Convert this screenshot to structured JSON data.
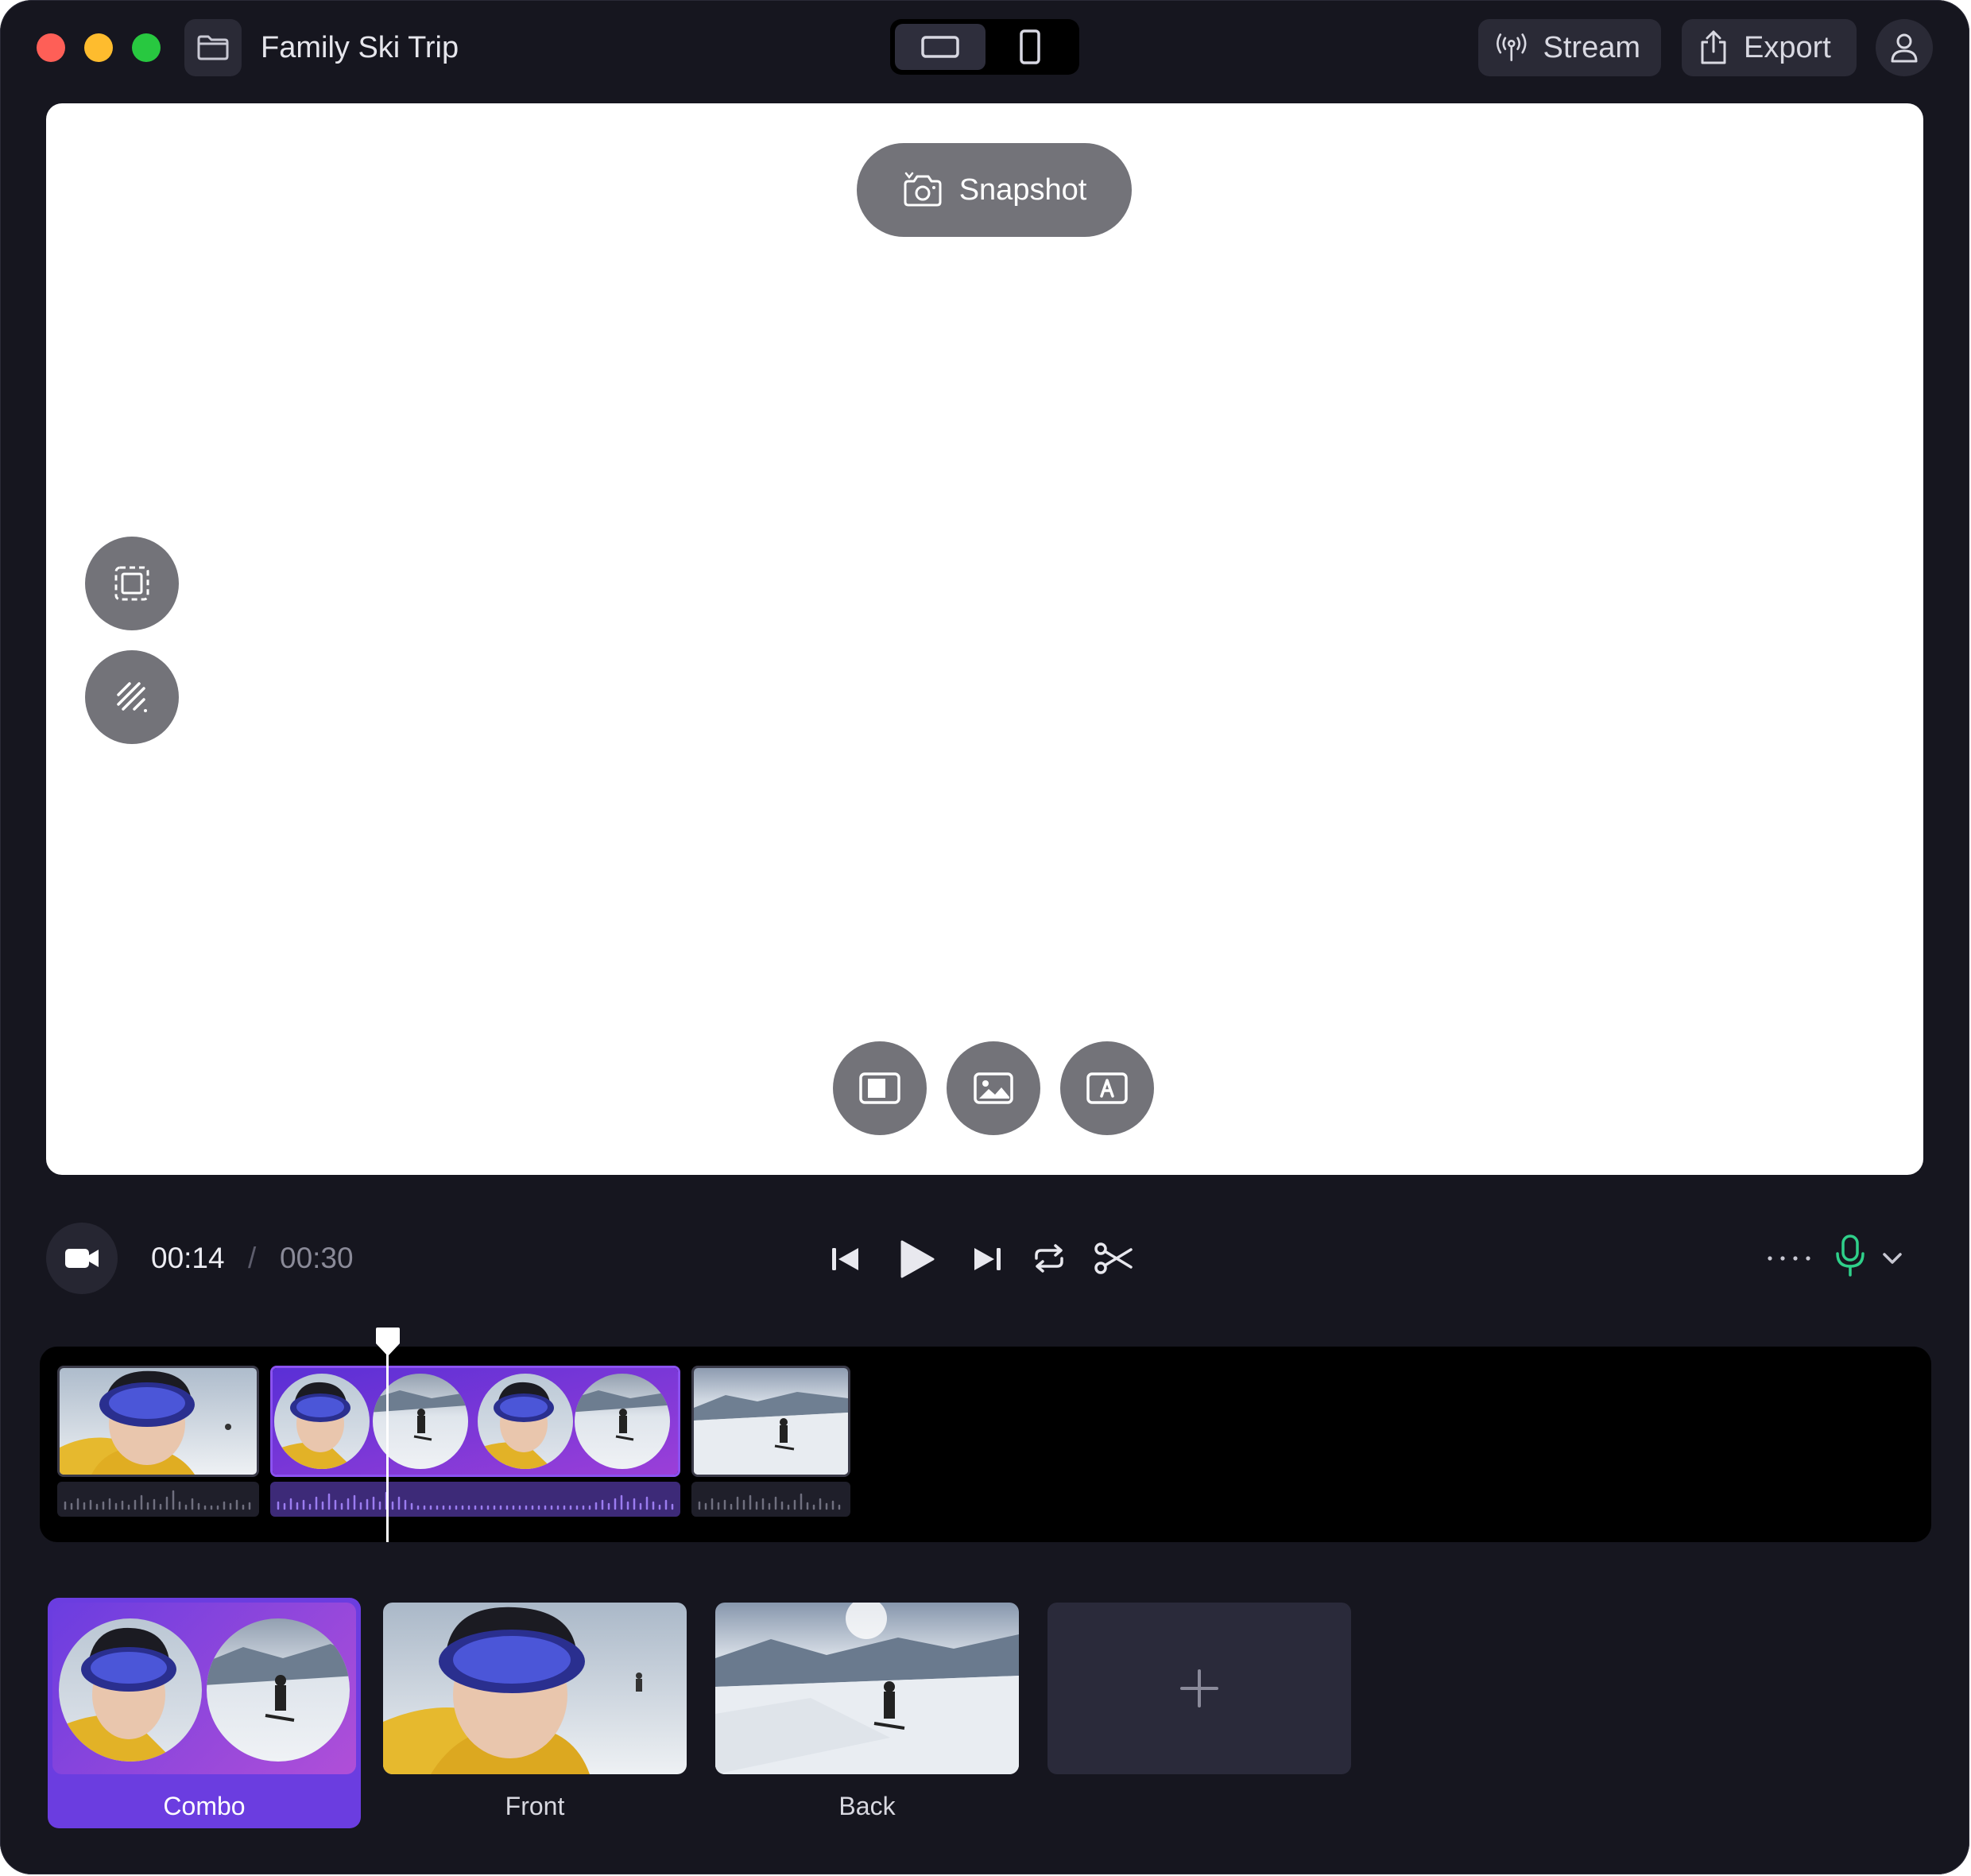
{
  "window": {
    "title": "Family Ski Trip"
  },
  "header": {
    "stream_label": "Stream",
    "export_label": "Export",
    "orientation": [
      "landscape",
      "portrait"
    ],
    "orientation_selected": "landscape"
  },
  "preview": {
    "snapshot_label": "Snapshot",
    "left_tools": [
      "crop-frame-icon",
      "stripes-icon"
    ],
    "bottom_tools": [
      "split-layout-icon",
      "image-icon",
      "caption-icon"
    ]
  },
  "transport": {
    "current_time": "00:14",
    "separator": "/",
    "total_time": "00:30",
    "playhead_progress": 0.4667
  },
  "cameras": [
    {
      "label": "Combo",
      "selected": true
    },
    {
      "label": "Front",
      "selected": false
    },
    {
      "label": "Back",
      "selected": false
    }
  ],
  "colors": {
    "accent": "#6b3de0",
    "mic": "#2fd08a",
    "window_bg": "#16161f"
  }
}
